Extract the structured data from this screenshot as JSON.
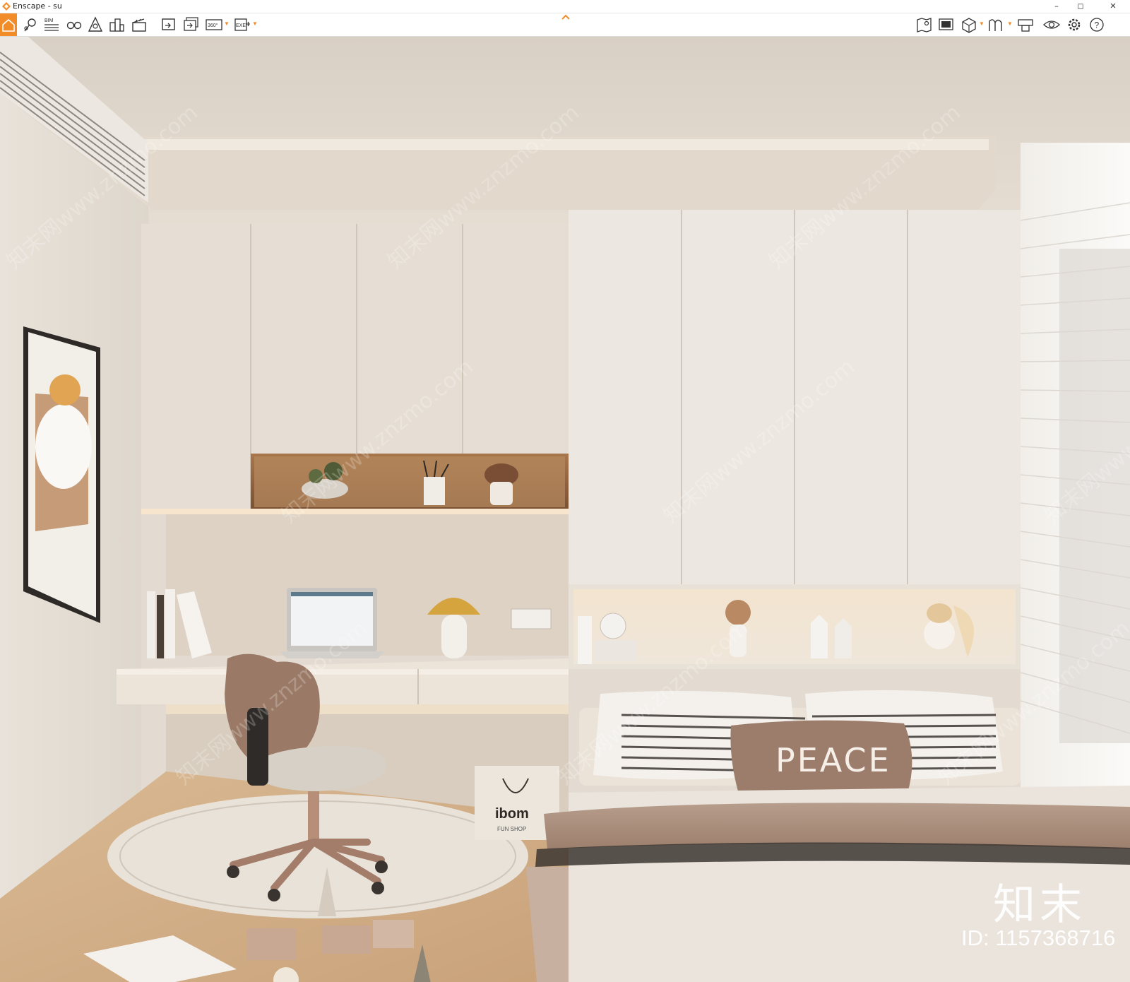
{
  "window": {
    "title": "Enscape - su",
    "controls": {
      "minimize": "–",
      "maximize": "◻",
      "close": "✕"
    }
  },
  "toolbar": {
    "left_groups": [
      [
        "home-icon",
        "views-icon",
        "bim-icon",
        "video-path-icon",
        "site-context-icon",
        "asset-library-icon",
        "material-editor-icon",
        "clapper-icon"
      ],
      [
        "render-screenshot-icon",
        "batch-render-icon",
        "panorama-360-icon",
        "export-exe-icon"
      ]
    ],
    "bim_label": "BIM",
    "pano_label": "360°",
    "exe_label": "EXE",
    "right_icons": [
      "minimap-icon",
      "visual-settings-icon",
      "section-view-icon",
      "atmosphere-icon",
      "capture-icon",
      "eye-icon",
      "settings-icon",
      "help-icon"
    ],
    "help_label": "?",
    "accent": "#f28c28"
  },
  "viewport": {
    "pillow_text": "PEACE",
    "bag_text": "ibom",
    "bag_subtext": "FUN SHOP",
    "watermark_text": "知末网www.znzmo.com",
    "logo_text": "知末",
    "id_text": "ID: 1157368716"
  }
}
